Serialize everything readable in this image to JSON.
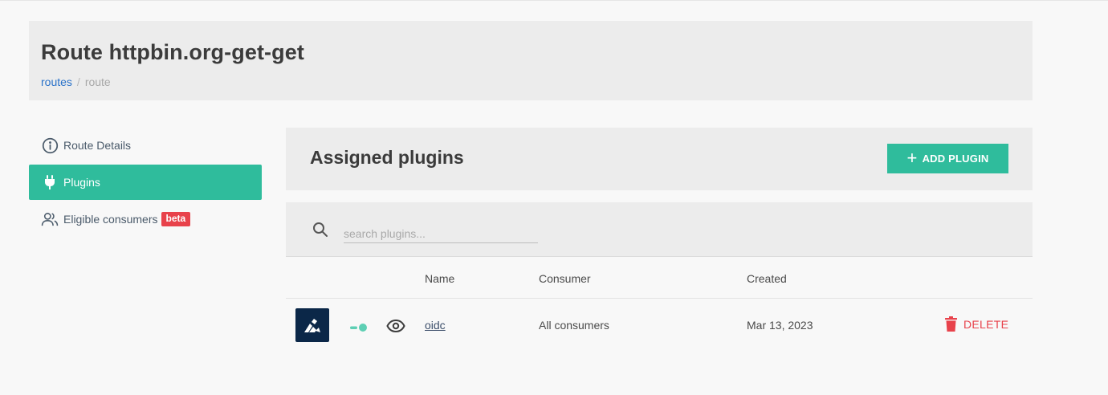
{
  "header": {
    "title": "Route httpbin.org-get-get",
    "breadcrumb": {
      "link": "routes",
      "separator": "/",
      "current": "route"
    }
  },
  "sidebar": {
    "items": [
      {
        "label": "Route Details",
        "icon": "info-circle-icon",
        "active": false
      },
      {
        "label": "Plugins",
        "icon": "plug-icon",
        "active": true
      },
      {
        "label": "Eligible consumers",
        "icon": "users-icon",
        "active": false,
        "badge": "beta"
      }
    ]
  },
  "main": {
    "title": "Assigned plugins",
    "add_button": {
      "icon": "plus-icon",
      "label": "ADD PLUGIN"
    },
    "search": {
      "placeholder": "search plugins...",
      "value": ""
    },
    "table": {
      "columns": [
        "Name",
        "Consumer",
        "Created"
      ],
      "rows": [
        {
          "logo": "kong-logo-icon",
          "enabled": true,
          "name": "oidc",
          "consumer": "All consumers",
          "created": "Mar 13, 2023",
          "delete_label": "DELETE"
        }
      ]
    }
  },
  "colors": {
    "accent": "#2fbc9c",
    "danger": "#e8424b",
    "link": "#2a72c9",
    "logo_bg": "#0b2748"
  }
}
